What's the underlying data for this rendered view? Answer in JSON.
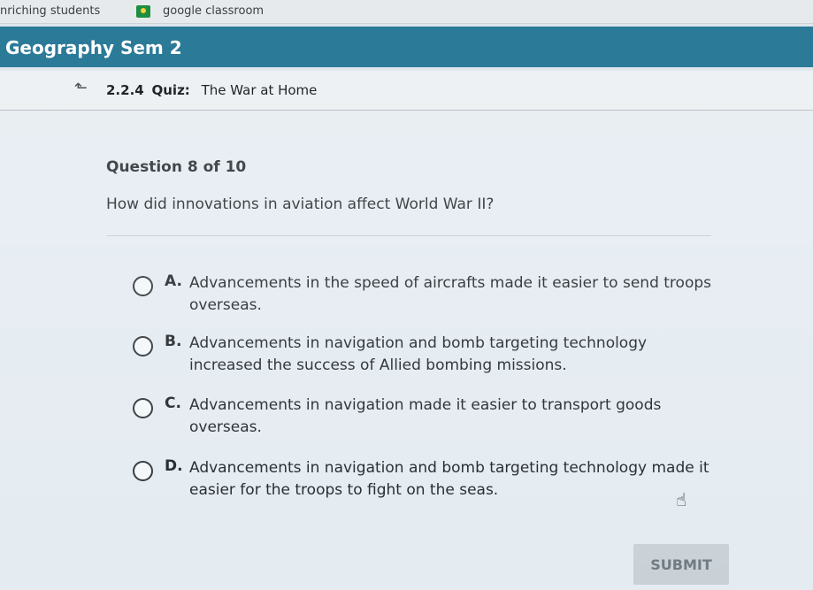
{
  "bookmarks": [
    {
      "label": "nriching students"
    },
    {
      "label": "google classroom",
      "icon": "classroom-icon"
    }
  ],
  "course": {
    "title": "Geography Sem 2"
  },
  "activity": {
    "number": "2.2.4",
    "kind": "Quiz:",
    "name": "The War at Home"
  },
  "question": {
    "number_label": "Question 8 of 10",
    "text": "How did innovations in aviation affect World War II?"
  },
  "options": [
    {
      "letter": "A.",
      "text": "Advancements in the speed of aircrafts made it easier to send troops overseas."
    },
    {
      "letter": "B.",
      "text": "Advancements in navigation and bomb targeting technology increased the success of Allied bombing missions."
    },
    {
      "letter": "C.",
      "text": "Advancements in navigation made it easier to transport goods overseas."
    },
    {
      "letter": "D.",
      "text": "Advancements in navigation and bomb targeting technology made it easier for the troops to fight on the seas."
    }
  ],
  "submit_label": "SUBMIT",
  "colors": {
    "header": "#2b7a98",
    "background": "#e4ebf1",
    "submit_bg": "#c9d1d7"
  }
}
